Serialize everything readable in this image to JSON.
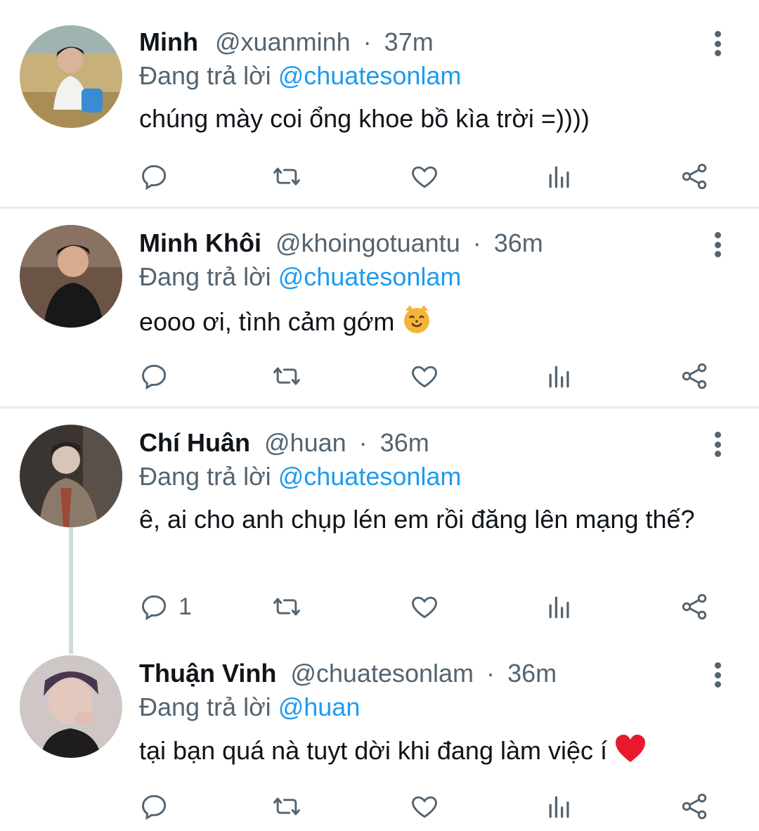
{
  "reply_prefix": "Đang trả lời",
  "tweets": [
    {
      "name": "Minh",
      "handle": "@xuanminh",
      "separator": "·",
      "time": "37m",
      "reply_to": "@chuatesonlam",
      "text": "chúng mày coi ổng khoe bồ kìa trời =))))",
      "reply_count": ""
    },
    {
      "name": "Minh Khôi",
      "handle": "@khoingotuantu",
      "separator": "·",
      "time": "36m",
      "reply_to": "@chuatesonlam",
      "text": "eooo ơi, tình cảm gớm",
      "emoji": "smiling-cat-face",
      "reply_count": ""
    },
    {
      "name": "Chí Huân",
      "handle": "@huan",
      "separator": "·",
      "time": "36m",
      "reply_to": "@chuatesonlam",
      "text": "ê, ai cho anh chụp lén em rồi đăng lên mạng thế?",
      "reply_count": "1"
    },
    {
      "name": "Thuận Vinh",
      "handle": "@chuatesonlam",
      "separator": "·",
      "time": "36m",
      "reply_to": "@huan",
      "text": "tại bạn quá nà tuyt dời khi đang làm việc í",
      "emoji": "red-heart",
      "reply_count": ""
    }
  ],
  "colors": {
    "text": "#0f1419",
    "secondary": "#536471",
    "link": "#1d9bf0",
    "divider": "#e6ecf0"
  },
  "icons": [
    "reply-icon",
    "retweet-icon",
    "like-icon",
    "views-icon",
    "share-icon",
    "more-icon"
  ]
}
